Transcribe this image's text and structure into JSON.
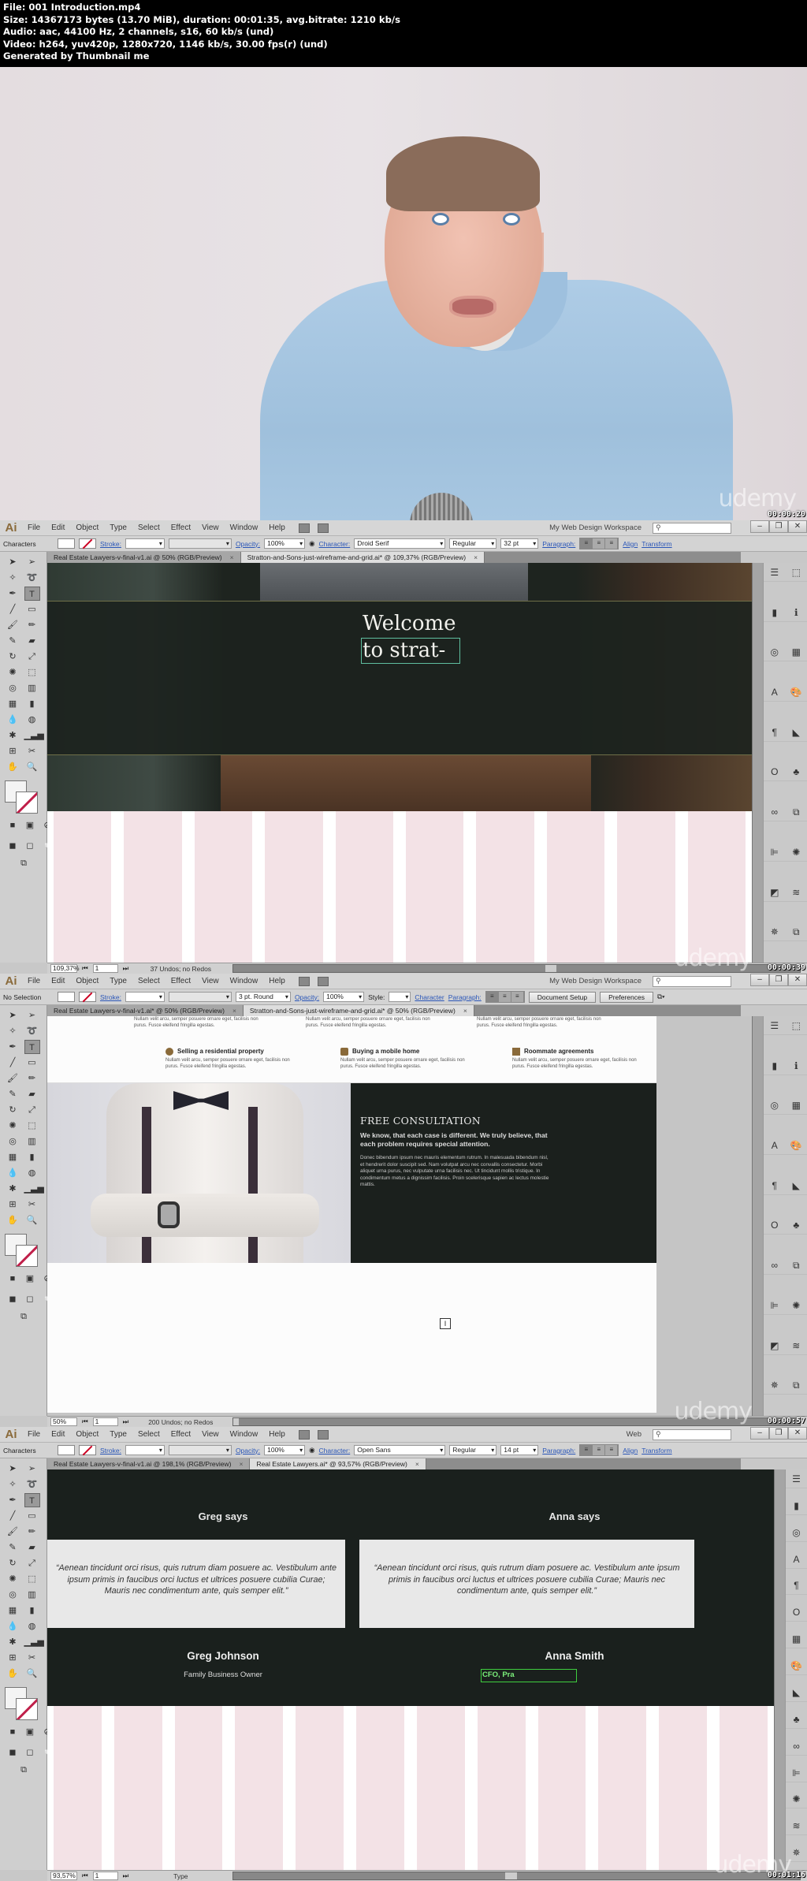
{
  "file_info": {
    "line1": "File: 001 Introduction.mp4",
    "line2": "Size: 14367173 bytes (13.70 MiB), duration: 00:01:35, avg.bitrate: 1210 kb/s",
    "line3": "Audio: aac, 44100 Hz, 2 channels, s16, 60 kb/s (und)",
    "line4": "Video: h264, yuv420p, 1280x720, 1146 kb/s, 30.00 fps(r) (und)",
    "line5": "Generated by Thumbnail me"
  },
  "watermark": "udemy",
  "frames": [
    {
      "timestamp": "00:00:20"
    },
    {
      "timestamp": "00:00:39",
      "menu": [
        "File",
        "Edit",
        "Object",
        "Type",
        "Select",
        "Effect",
        "View",
        "Window",
        "Help"
      ],
      "workspace": "My Web Design Workspace",
      "search_placeholder": "⚲",
      "control": {
        "label": "Characters",
        "stroke": "Stroke:",
        "opacity_label": "Opacity:",
        "opacity": "100%",
        "character_label": "Character:",
        "font": "Droid Serif",
        "style": "Regular",
        "size": "32 pt",
        "paragraph_label": "Paragraph:",
        "align": "Align",
        "transform": "Transform"
      },
      "tabs": [
        {
          "label": "Real Estate Lawyers-v-final-v1.ai @ 50% (RGB/Preview)",
          "active": false
        },
        {
          "label": "Stratton-and-Sons-just-wireframe-and-grid.ai* @ 109,37% (RGB/Preview)",
          "active": true
        }
      ],
      "canvas": {
        "heading_line1": "Welcome",
        "heading_line2": "to strat-"
      },
      "status": {
        "zoom": "109,37%",
        "page": "1",
        "text": "37 Undos; no Redos"
      }
    },
    {
      "timestamp": "00:00:57",
      "workspace": "My Web Design Workspace",
      "control": {
        "label": "No Selection",
        "stroke": "Stroke:",
        "brush": "3 pt. Round",
        "opacity_label": "Opacity:",
        "opacity": "100%",
        "style_label": "Style:",
        "character_label": "Character",
        "paragraph_label": "Paragraph:",
        "document_setup": "Document Setup",
        "preferences": "Preferences"
      },
      "tabs": [
        {
          "label": "Real Estate Lawyers-v-final-v1.ai* @ 50% (RGB/Preview)",
          "active": false
        },
        {
          "label": "Stratton-and-Sons-just-wireframe-and-grid.ai* @ 50% (RGB/Preview)",
          "active": true
        }
      ],
      "services": [
        {
          "title": "Selling a residential property",
          "body": "Nullam velit arcu, semper posuere ornare eget, facilisis non purus. Fusce eleifend fringilla egestas."
        },
        {
          "title": "Buying a mobile home",
          "body": "Nullam velit arcu, semper posuere ornare eget, facilisis non purus. Fusce eleifend fringilla egestas."
        },
        {
          "title": "Roommate agreements",
          "body": "Nullam velit arcu, semper posuere ornare eget, facilisis non purus. Fusce eleifend fringilla egestas."
        }
      ],
      "services_partial_body": "Nullam velit arcu, semper posuere ornare eget, facilisis non purus. Fusce eleifend fringilla egestas.",
      "consultation": {
        "title": "FREE CONSULTATION",
        "lead": "We know, that each case is different. We truly believe, that each problem requires special attention.",
        "body": "Donec bibendum ipsum nec mauris elementum rutrum. In malesuada bibendum nisl, et hendrerit dolor suscipit sed. Nam volutpat arcu nec convallis consectetur. Morbi aliquet urna purus, nec vulputate urna facilisis nec. Ut tincidunt mollis tristique. In condimentum metus a dignissim facilisis. Proin scelerisque sapien ac lectus molestie mattis."
      },
      "status": {
        "zoom": "50%",
        "page": "1",
        "text": "200 Undos; no Redos"
      }
    },
    {
      "timestamp": "00:01:16",
      "workspace": "Web",
      "control": {
        "label": "Characters",
        "stroke": "Stroke:",
        "opacity_label": "Opacity:",
        "opacity": "100%",
        "character_label": "Character:",
        "font": "Open Sans",
        "style": "Regular",
        "size": "14 pt",
        "paragraph_label": "Paragraph:",
        "align": "Align",
        "transform": "Transform"
      },
      "tabs": [
        {
          "label": "Real Estate Lawyers-v-final-v1.ai @ 198,1% (RGB/Preview)",
          "active": false
        },
        {
          "label": "Real Estate Lawyers.ai* @ 93,57% (RGB/Preview)",
          "active": true
        }
      ],
      "testimonials": [
        {
          "says": "Greg says",
          "quote": "“Aenean tincidunt orci risus, quis rutrum diam posuere ac. Vestibulum ante ipsum primis in faucibus orci luctus et ultrices posuere cubilia Curae; Mauris nec condimentum ante, quis semper elit.”",
          "name": "Greg Johnson",
          "role": "Family Business Owner"
        },
        {
          "says": "Anna says",
          "quote": "“Aenean tincidunt orci risus, quis rutrum diam posuere ac. Vestibulum ante ipsum primis in faucibus orci luctus et ultrices posuere cubilia Curae; Mauris nec condimentum ante, quis semper elit.”",
          "name": "Anna Smith",
          "role": "CFO, Pra"
        }
      ],
      "status": {
        "zoom": "93,57%",
        "page": "1",
        "text": "Type"
      }
    }
  ]
}
